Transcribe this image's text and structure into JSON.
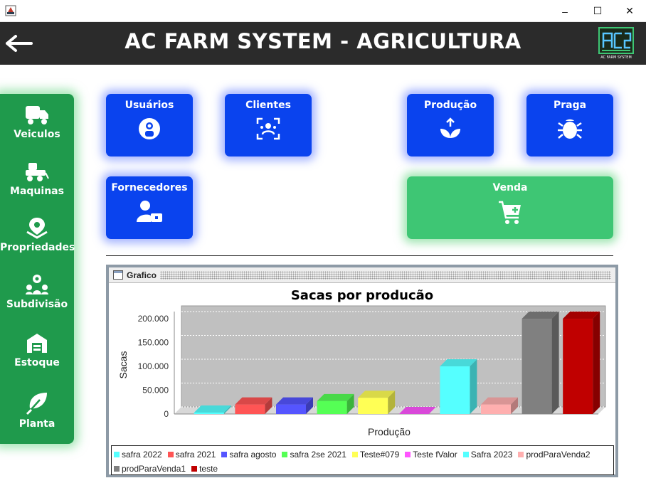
{
  "window": {
    "minimize": "–",
    "maximize": "☐",
    "close": "✕"
  },
  "header": {
    "title": "AC FARM SYSTEM - AGRICULTURA",
    "logo_text": "AC FARM SYSTEM"
  },
  "sidebar": {
    "items": [
      {
        "label": "Veiculos",
        "icon": "truck-icon"
      },
      {
        "label": "Maquinas",
        "icon": "tractor-icon"
      },
      {
        "label": "Propriedades",
        "icon": "map-pin-icon"
      },
      {
        "label": "Subdivisão",
        "icon": "users-pin-icon"
      },
      {
        "label": "Estoque",
        "icon": "warehouse-icon"
      },
      {
        "label": "Planta",
        "icon": "leaf-icon"
      }
    ]
  },
  "tiles": {
    "usuarios": "Usuários",
    "clientes": "Clientes",
    "producao": "Produção",
    "praga": "Praga",
    "fornecedores": "Fornecedores",
    "venda": "Venda"
  },
  "colors": {
    "header": "#2b2b2b",
    "sidebar": "#1f9a4c",
    "tile_blue": "#0a43ee",
    "tile_green": "#3ec674"
  },
  "panel": {
    "title": "Grafico"
  },
  "chart_data": {
    "type": "bar",
    "title": "Sacas por producão",
    "xlabel": "Produção",
    "ylabel": "Sacas",
    "ylim": [
      0,
      215000
    ],
    "yticks": [
      "0",
      "50.000",
      "100.000",
      "150.000",
      "200.000"
    ],
    "grid": true,
    "legend": "bottom",
    "series": [
      {
        "name": "safra 2022",
        "values": [
          3000
        ],
        "color": "#55ffff"
      },
      {
        "name": "safra 2021",
        "values": [
          20000
        ],
        "color": "#ff5555"
      },
      {
        "name": "safra agosto",
        "values": [
          20000
        ],
        "color": "#5555ff"
      },
      {
        "name": "safra 2se 2021",
        "values": [
          27000
        ],
        "color": "#55ff55"
      },
      {
        "name": "Teste#079",
        "values": [
          34000
        ],
        "color": "#ffff55"
      },
      {
        "name": "Teste fValor",
        "values": [
          0
        ],
        "color": "#ff55ff"
      },
      {
        "name": "Safra 2023",
        "values": [
          100000
        ],
        "color": "#55ffff"
      },
      {
        "name": "prodParaVenda2",
        "values": [
          20000
        ],
        "color": "#ffafaf"
      },
      {
        "name": "prodParaVenda1",
        "values": [
          200000
        ],
        "color": "#808080"
      },
      {
        "name": "teste",
        "values": [
          200000
        ],
        "color": "#c00000"
      }
    ]
  }
}
